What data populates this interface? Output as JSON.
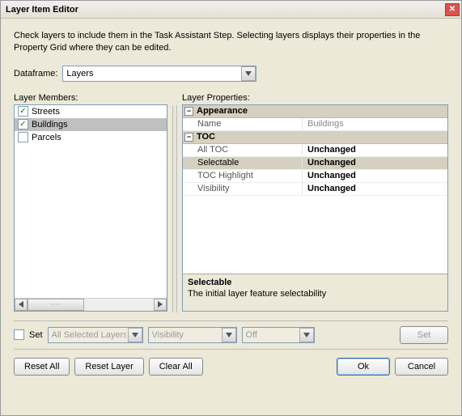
{
  "window": {
    "title": "Layer Item Editor"
  },
  "instructions": "Check layers to include them in the Task Assistant Step. Selecting layers displays their properties in the Property Grid where they can be edited.",
  "dataframe": {
    "label": "Dataframe:",
    "value": "Layers"
  },
  "layerMembers": {
    "label": "Layer Members:",
    "items": [
      {
        "label": "Streets",
        "checked": true,
        "selected": false
      },
      {
        "label": "Buildings",
        "checked": true,
        "selected": true
      },
      {
        "label": "Parcels",
        "checked": false,
        "selected": false
      }
    ]
  },
  "layerProperties": {
    "label": "Layer Properties:",
    "categories": [
      {
        "name": "Appearance",
        "props": [
          {
            "name": "Name",
            "value": "Buildings",
            "dim": true,
            "selected": false
          }
        ]
      },
      {
        "name": "TOC",
        "props": [
          {
            "name": "All TOC",
            "value": "Unchanged",
            "selected": false
          },
          {
            "name": "Selectable",
            "value": "Unchanged",
            "selected": true
          },
          {
            "name": "TOC Highlight",
            "value": "Unchanged",
            "selected": false
          },
          {
            "name": "Visibility",
            "value": "Unchanged",
            "selected": false
          }
        ]
      }
    ],
    "description": {
      "title": "Selectable",
      "text": "The initial layer feature selectability"
    }
  },
  "setRow": {
    "checkboxLabel": "Set",
    "scope": "All Selected Layers",
    "property": "Visibility",
    "value": "Off",
    "button": "Set"
  },
  "footer": {
    "resetAll": "Reset All",
    "resetLayer": "Reset Layer",
    "clearAll": "Clear All",
    "ok": "Ok",
    "cancel": "Cancel"
  }
}
